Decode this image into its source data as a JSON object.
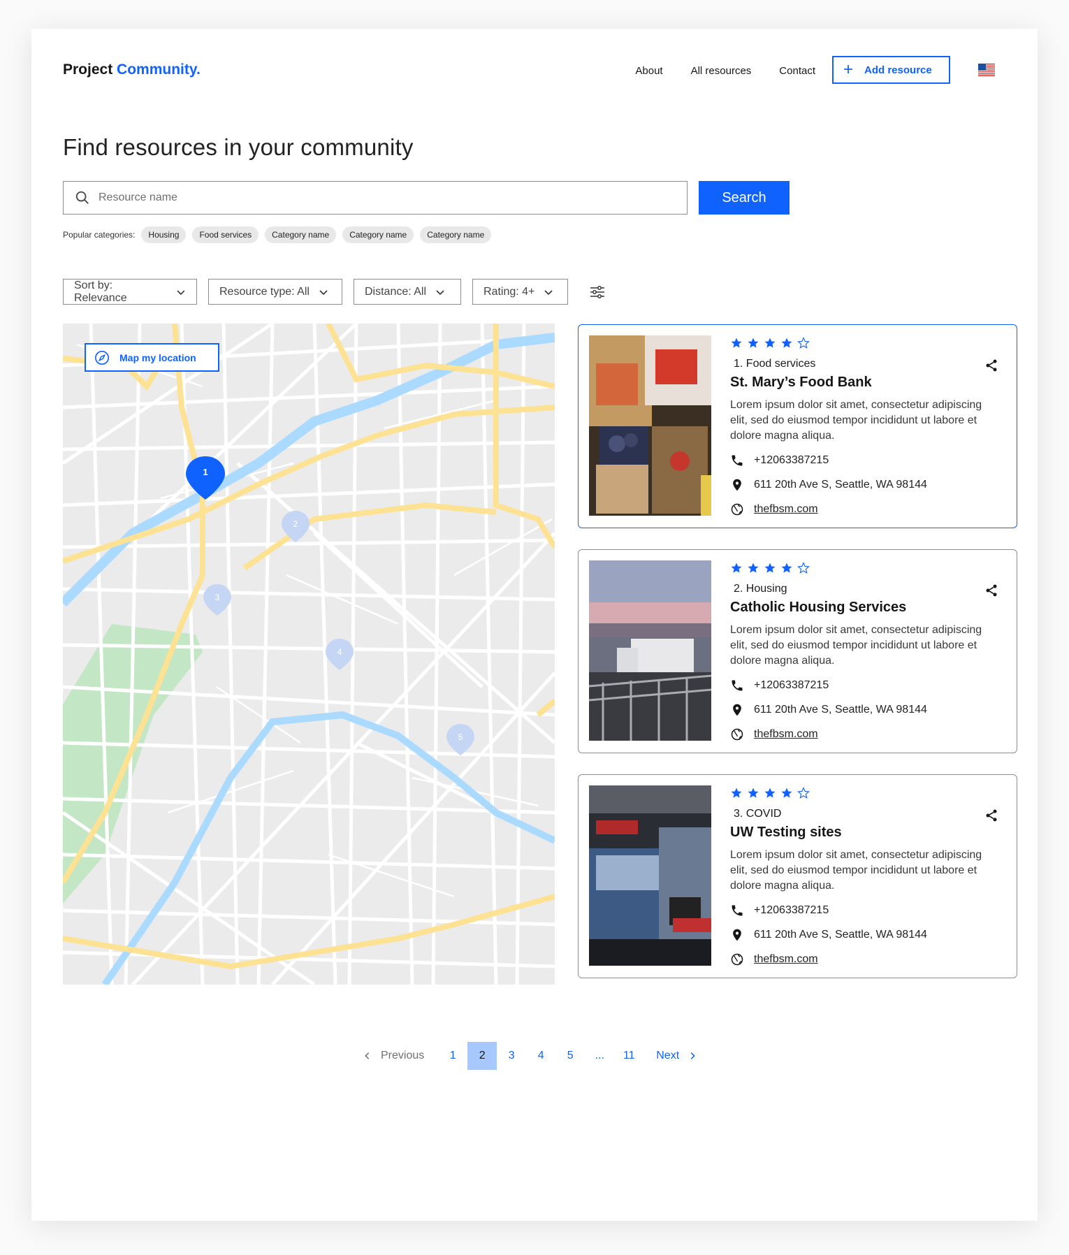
{
  "header": {
    "logo_main": "Project",
    "logo_accent": "Community.",
    "nav": [
      "About",
      "All resources",
      "Contact"
    ],
    "add_resource_label": "Add resource",
    "language_flag": "us-flag-icon"
  },
  "page_title": "Find resources in your community",
  "search": {
    "placeholder": "Resource name",
    "value": "",
    "button_label": "Search"
  },
  "categories": {
    "label": "Popular categories:",
    "chips": [
      "Housing",
      "Food services",
      "Category name",
      "Category name",
      "Category name"
    ]
  },
  "filters": {
    "sort": "Sort by: Relevance",
    "resource_type": "Resource type: All",
    "distance": "Distance: All",
    "rating": "Rating: 4+"
  },
  "map": {
    "locate_label": "Map my location",
    "pins": [
      "1",
      "2",
      "3",
      "4",
      "5"
    ],
    "active_pin": "1"
  },
  "results": [
    {
      "rating": 4,
      "category": "1. Food services",
      "name": "St. Mary’s Food Bank",
      "description": "Lorem ipsum dolor sit amet, consectetur adipiscing elit, sed do eiusmod tempor incididunt ut labore et dolore magna aliqua.",
      "phone": "+12063387215",
      "address": "611 20th Ave S, Seattle, WA 98144",
      "website": "thefbsm.com"
    },
    {
      "rating": 4,
      "category": "2. Housing",
      "name": "Catholic Housing Services",
      "description": "Lorem ipsum dolor sit amet, consectetur adipiscing elit, sed do eiusmod tempor incididunt ut labore et dolore magna aliqua.",
      "phone": "+12063387215",
      "address": "611 20th Ave S, Seattle, WA 98144",
      "website": "thefbsm.com"
    },
    {
      "rating": 4,
      "category": "3. COVID",
      "name": "UW Testing sites",
      "description": "Lorem ipsum dolor sit amet, consectetur adipiscing elit, sed do eiusmod tempor incididunt ut labore et dolore magna aliqua.",
      "phone": "+12063387215",
      "address": "611 20th Ave S, Seattle, WA 98144",
      "website": "thefbsm.com"
    }
  ],
  "pagination": {
    "previous": "Previous",
    "pages": [
      "1",
      "2",
      "3",
      "4",
      "5",
      "...",
      "11"
    ],
    "current": "2",
    "next": "Next"
  },
  "colors": {
    "accent": "#0f62fe",
    "current_page": "#a6c8ff",
    "map_road_major": "#fde293",
    "map_water": "#aadaff",
    "map_park": "#c3e6c5"
  }
}
